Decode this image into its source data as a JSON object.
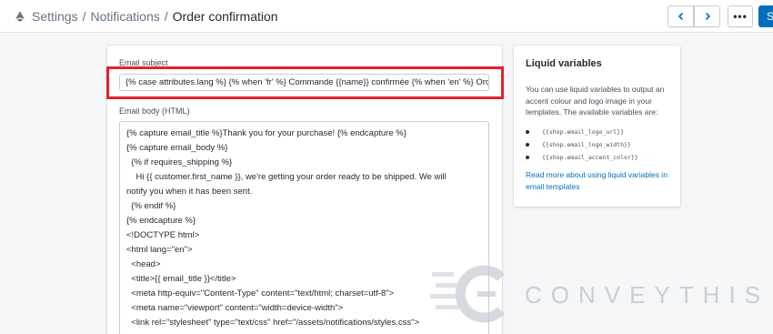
{
  "breadcrumb": {
    "items": [
      "Settings",
      "Notifications"
    ],
    "separator": "/",
    "current": "Order confirmation"
  },
  "toolbar": {
    "prev_icon": "chevron-left-icon",
    "next_icon": "chevron-right-icon",
    "more_label": "•••",
    "save_label": "S"
  },
  "email": {
    "subject_label": "Email subject",
    "subject_value": "{% case attributes.lang %}  {% when 'fr' %} Commande {{name}} confirmée  {% when 'en' %} Order {{name}} confirmed {% endcase %}",
    "body_label": "Email body (HTML)",
    "body_lines": [
      "{% capture email_title %}Thank you for your purchase! {% endcapture %}",
      "{% capture email_body %}",
      "  {% if requires_shipping %}",
      "    Hi {{ customer.first_name }}, we're getting your order ready to be shipped. We will",
      "notify you when it has been sent.",
      "  {% endif %}",
      "{% endcapture %}",
      "",
      "<!DOCTYPE html>",
      "<html lang=\"en\">",
      "  <head>",
      "  <title>{{ email_title }}</title>",
      "  <meta http-equiv=\"Content-Type\" content=\"text/html; charset=utf-8\">",
      "  <meta name=\"viewport\" content=\"width=device-width\">",
      "  <link rel=\"stylesheet\" type=\"text/css\" href=\"/assets/notifications/styles.css\">"
    ]
  },
  "liquid": {
    "title": "Liquid variables",
    "description": "You can use liquid variables to output an accent colour and logo image in your templates. The available variables are:",
    "variables": [
      "{{shop.email_logo_url}}",
      "{{shop.email_logo_width}}",
      "{{shop.email_accent_color}}"
    ],
    "link_text": "Read more about using liquid variables in email templates"
  },
  "watermark": {
    "text": "CONVEYTHIS"
  },
  "colors": {
    "accent": "#006fbb",
    "highlight": "#e5212c",
    "watermark": "#c9ced6"
  }
}
